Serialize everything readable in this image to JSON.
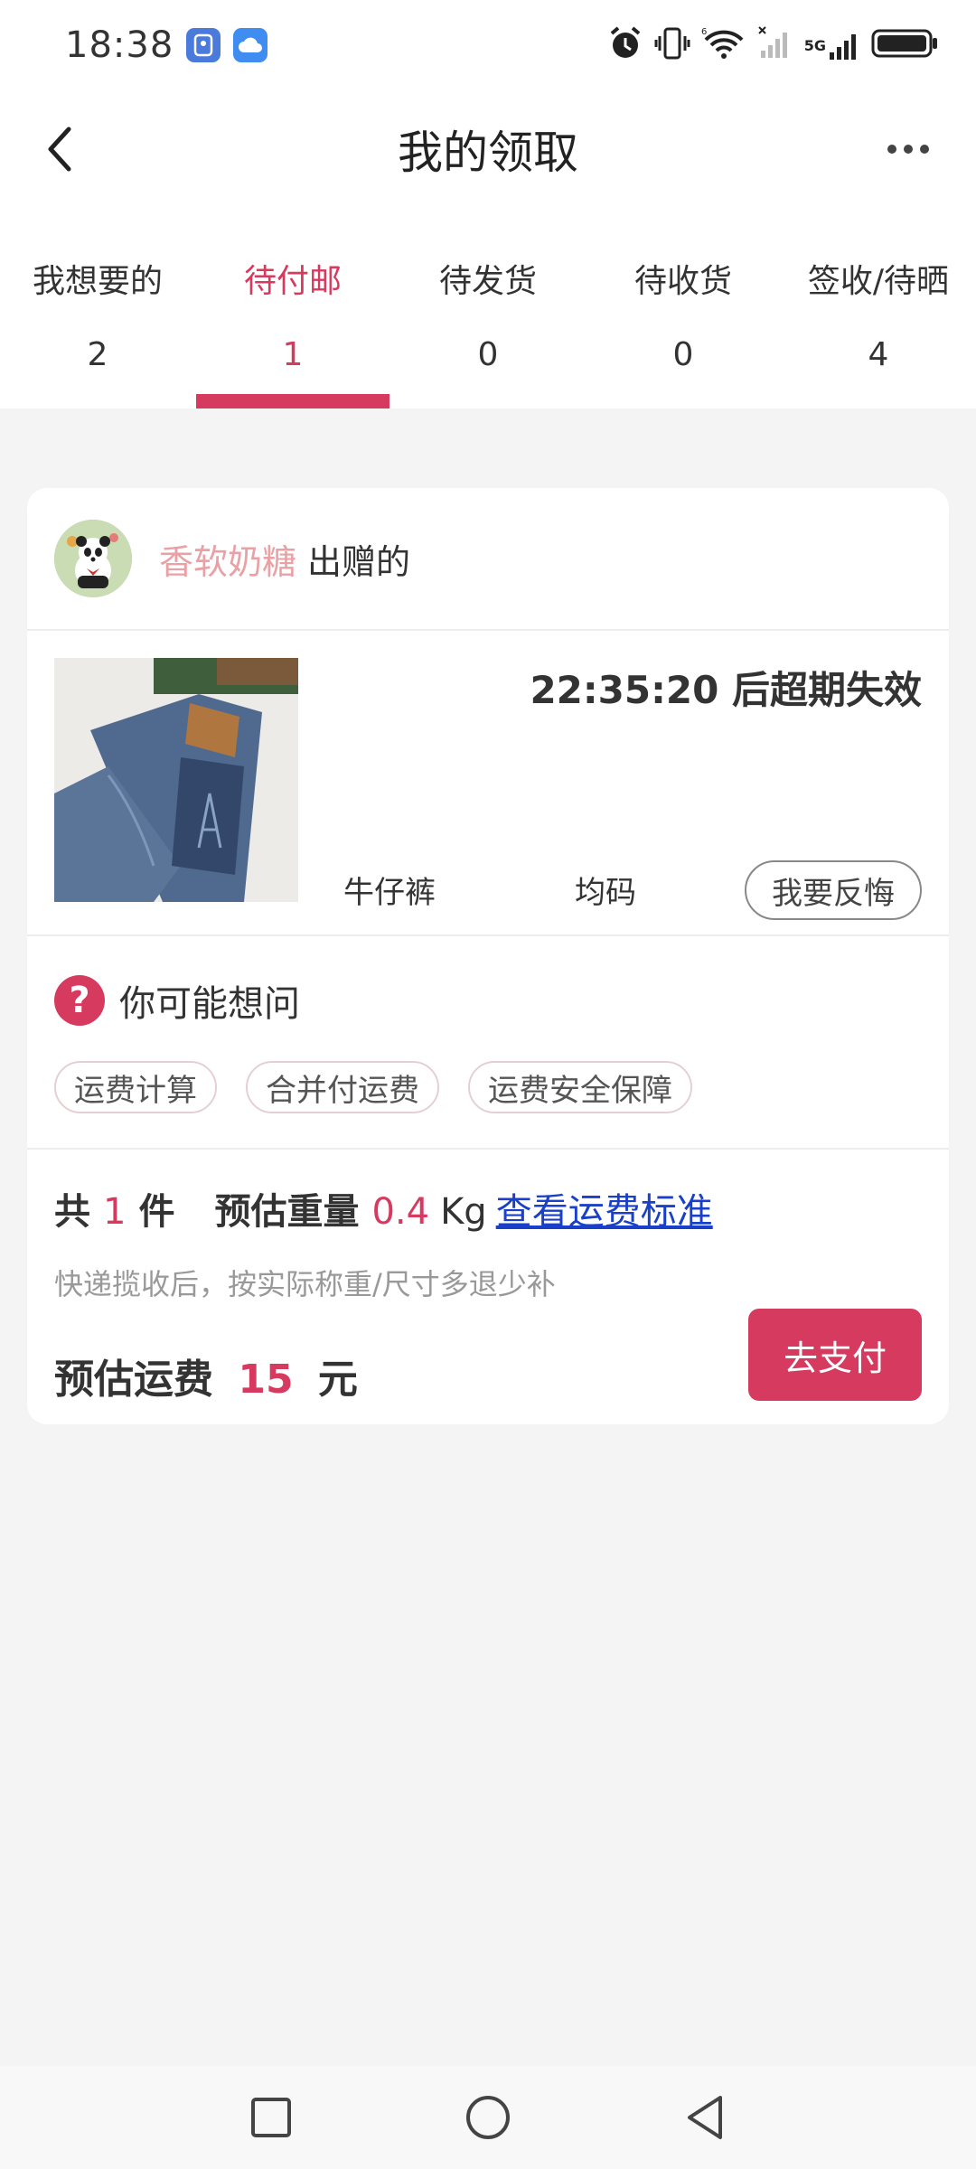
{
  "status_bar": {
    "time": "18:38",
    "network": "5G",
    "icons": [
      "app-tile-icon",
      "cloud-icon",
      "alarm-icon",
      "vibrate-icon",
      "wifi-icon",
      "signal-icon",
      "battery-icon"
    ]
  },
  "header": {
    "title": "我的领取",
    "back_icon": "chevron-left-icon",
    "more_icon": "more-dots-icon"
  },
  "tabs": [
    {
      "label": "我想要的",
      "count": "2",
      "active": false
    },
    {
      "label": "待付邮",
      "count": "1",
      "active": true
    },
    {
      "label": "待发货",
      "count": "0",
      "active": false
    },
    {
      "label": "待收货",
      "count": "0",
      "active": false
    },
    {
      "label": "签收/待晒",
      "count": "4",
      "active": false
    }
  ],
  "card": {
    "donor": {
      "name": "香软奶糖",
      "suffix": "出赠的"
    },
    "product": {
      "countdown": "22:35:20 后超期失效",
      "name": "牛仔裤",
      "size": "均码",
      "regret_label": "我要反悔"
    },
    "faq": {
      "title": "你可能想问",
      "chips": [
        "运费计算",
        "合并付运费",
        "运费安全保障"
      ]
    },
    "summary": {
      "count_prefix": "共",
      "count": "1",
      "count_suffix": "件",
      "weight_label": "预估重量",
      "weight_value": "0.4",
      "weight_unit": "Kg",
      "link": "查看运费标准",
      "note": "快递揽收后，按实际称重/尺寸多退少补",
      "fee_label": "预估运费",
      "fee_value": "15",
      "fee_unit": "元",
      "pay_label": "去支付"
    }
  },
  "colors": {
    "accent": "#d63a5e",
    "link": "#1a3fc8",
    "donor_name": "#e9a1a6",
    "background": "#f4f4f5"
  }
}
